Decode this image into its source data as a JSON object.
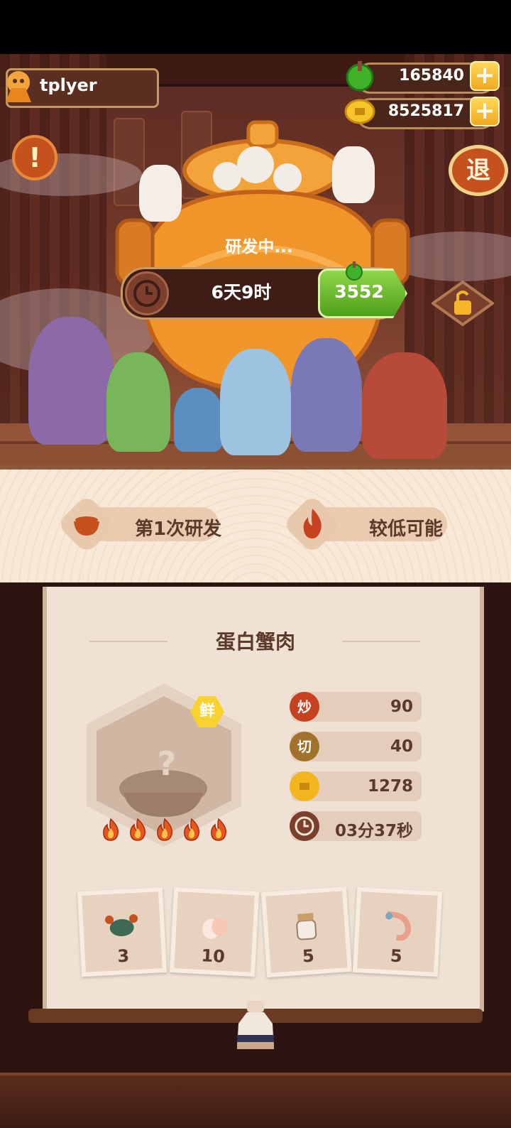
{
  "player": {
    "name": "tplyer"
  },
  "resources": {
    "jade": "165840",
    "coins": "8525817"
  },
  "buttons": {
    "plus": "+",
    "alert": "!",
    "retreat": "退"
  },
  "research": {
    "status": "研发中...",
    "timer": "6天9时",
    "speedup_cost": "3552"
  },
  "info": {
    "attempt": "第1次研发",
    "chance": "较低可能"
  },
  "recipe": {
    "name": "蛋白蟹肉",
    "badge": "鲜",
    "placeholder": "?",
    "heat_level": 5,
    "stats": [
      {
        "icon": "炒",
        "value": "90",
        "color": "#c5411f"
      },
      {
        "icon": "切",
        "value": "40",
        "color": "#a3712e"
      },
      {
        "icon": "coin",
        "value": "1278",
        "color": "#f2b51e"
      },
      {
        "icon": "clock",
        "value": "03分37秒",
        "color": "#7b3f2c"
      }
    ]
  },
  "ingredients": [
    {
      "name": "crab",
      "count": "3"
    },
    {
      "name": "egg",
      "count": "10"
    },
    {
      "name": "jar",
      "count": "5"
    },
    {
      "name": "shrimp",
      "count": "5"
    }
  ]
}
